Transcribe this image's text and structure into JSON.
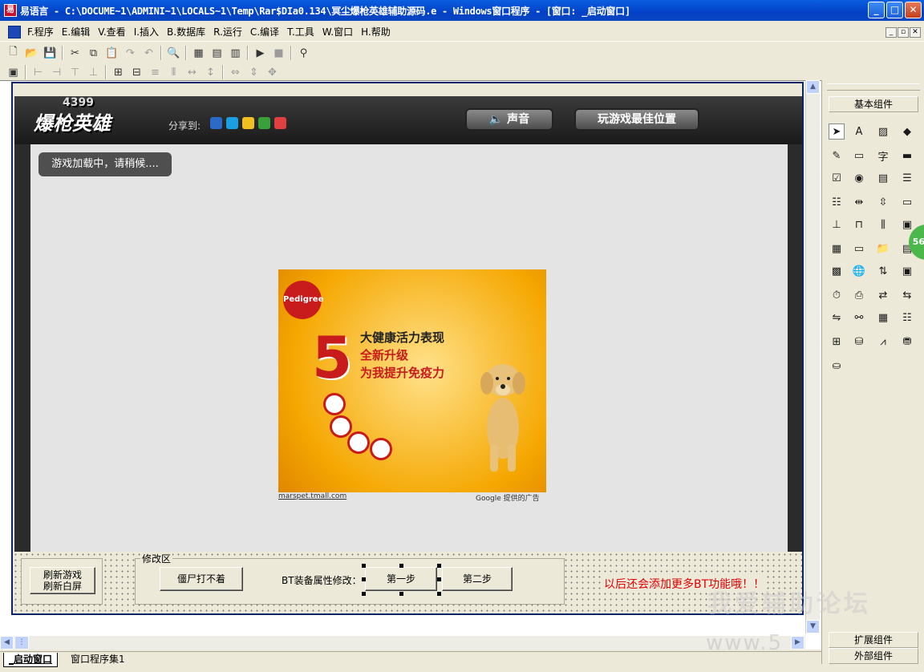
{
  "window": {
    "title": "易语言 - C:\\DOCUME~1\\ADMINI~1\\LOCALS~1\\Temp\\Rar$DIa0.134\\冥尘爆枪英雄辅助源码.e - Windows窗口程序 - [窗口: _启动窗口]"
  },
  "menu": [
    "F.程序",
    "E.编辑",
    "V.查看",
    "I.插入",
    "B.数据库",
    "R.运行",
    "C.编译",
    "T.工具",
    "W.窗口",
    "H.帮助"
  ],
  "game": {
    "logo": "爆枪英雄",
    "logo_top": "4399",
    "share_label": "分享到:",
    "sound_button": "声音",
    "best_position_button": "玩游戏最佳位置",
    "loading_text": "游戏加载中，请稍候....",
    "ad": {
      "brand": "Pedigree",
      "line1": "大健康活力表现",
      "line2": "全新升级",
      "line3": "为我提升免疫力",
      "number": "5",
      "link": "marspet.tmall.com",
      "provider": "Google 提供的广告"
    }
  },
  "controls": {
    "refresh_game": "刷新游戏",
    "refresh_white": "刷新白屏",
    "group_label": "修改区",
    "zombie_button": "僵尸打不着",
    "bt_label": "BT装备属性修改：",
    "step1": "第一步",
    "step2": "第二步",
    "notice": "以后还会添加更多BT功能哦！！"
  },
  "panel": {
    "basic": "基本组件",
    "extended": "扩展组件",
    "external": "外部组件",
    "badge": "56"
  },
  "tabs": {
    "start_window": "_启动窗口",
    "program_set": "窗口程序集1"
  },
  "watermark": {
    "line1": "我爱辅助论坛",
    "line2": "www.5"
  }
}
